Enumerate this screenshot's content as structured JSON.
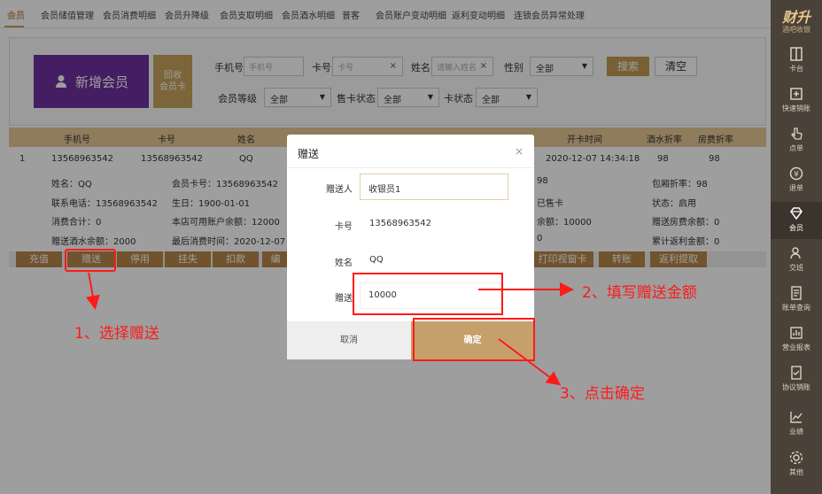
{
  "topnav": {
    "tabs": [
      "会员",
      "会员储值管理",
      "会员消费明细",
      "会员升降级",
      "会员支取明细",
      "会员酒水明细",
      "普客",
      "会员账户变动明细",
      "返利变动明细",
      "连锁会员异常处理"
    ]
  },
  "toolbar": {
    "new_member": "新增会员",
    "recycle_line1": "回收",
    "recycle_line2": "会员卡",
    "phone_label": "手机号",
    "phone_placeholder": "手机号",
    "card_label": "卡号",
    "card_placeholder": "卡号",
    "name_label": "姓名",
    "name_placeholder": "请输入姓名",
    "gender_label": "性别",
    "gender_value": "全部",
    "search": "搜索",
    "clear": "清空",
    "level_label": "会员等级",
    "level_value": "全部",
    "sale_status_label": "售卡状态",
    "sale_status_value": "全部",
    "card_status_label": "卡状态",
    "card_status_value": "全部"
  },
  "table": {
    "headers": [
      "手机号",
      "卡号",
      "姓名",
      "开卡时间",
      "酒水折率",
      "房费折率"
    ],
    "row": {
      "index": "1",
      "phone": "13568963542",
      "card": "13568963542",
      "name": "QQ",
      "open_time": "2020-12-07 14:34:18",
      "drink_rate": "98",
      "room_rate": "98"
    }
  },
  "detail": {
    "name": "姓名：QQ",
    "card": "会员卡号：13568963542",
    "phone": "联系电话：13568963542",
    "birthday": "生日：1900-01-01",
    "total": "消费合计：0",
    "balance": "本店可用账户余额：12000",
    "gift_drink": "赠送酒水余额：2000",
    "last_time": "最后消费时间：2020-12-07 14:",
    "r1": "98",
    "r2": "已售卡",
    "r3": "余额：10000",
    "r4": "0",
    "package_rate": "包厢折率：98",
    "state": "状态：启用",
    "gift_room": "赠送房费余额：0",
    "rebate": "累计返利金额：0"
  },
  "actions": [
    "充值",
    "赠送",
    "停用",
    "挂失",
    "扣款",
    "编",
    "打印视窗卡",
    "转账",
    "返利提取"
  ],
  "modal": {
    "title": "赠送",
    "close": "×",
    "giver_label": "赠送人",
    "giver_value": "收银员1",
    "card_label": "卡号",
    "card_value": "13568963542",
    "name_label": "姓名",
    "name_value": "QQ",
    "amount_label": "赠送",
    "amount_value": "10000",
    "cancel": "取消",
    "ok": "确定"
  },
  "sidebar": {
    "logo": "财升",
    "subtitle": "酒吧收银",
    "items": [
      {
        "label": "卡台",
        "icon": "table-icon"
      },
      {
        "label": "快速销账",
        "icon": "quick-pay-icon"
      },
      {
        "label": "点单",
        "icon": "tap-icon"
      },
      {
        "label": "退单",
        "icon": "refund-icon"
      },
      {
        "label": "会员",
        "icon": "diamond-icon"
      },
      {
        "label": "交班",
        "icon": "handover-icon"
      },
      {
        "label": "账单查询",
        "icon": "bill-icon"
      },
      {
        "label": "营业报表",
        "icon": "report-icon"
      },
      {
        "label": "协议销账",
        "icon": "agreement-icon"
      },
      {
        "label": "业绩",
        "icon": "chart-icon"
      },
      {
        "label": "其他",
        "icon": "gear-icon"
      }
    ]
  },
  "annotations": {
    "step1": "1、选择赠送",
    "step2": "2、填写赠送金额",
    "step3": "3、点击确定"
  },
  "colors": {
    "accent": "#c9a063",
    "purple": "#6e2f9e",
    "annotation": "#ff1a1a",
    "sidebar": "#4a4139"
  }
}
